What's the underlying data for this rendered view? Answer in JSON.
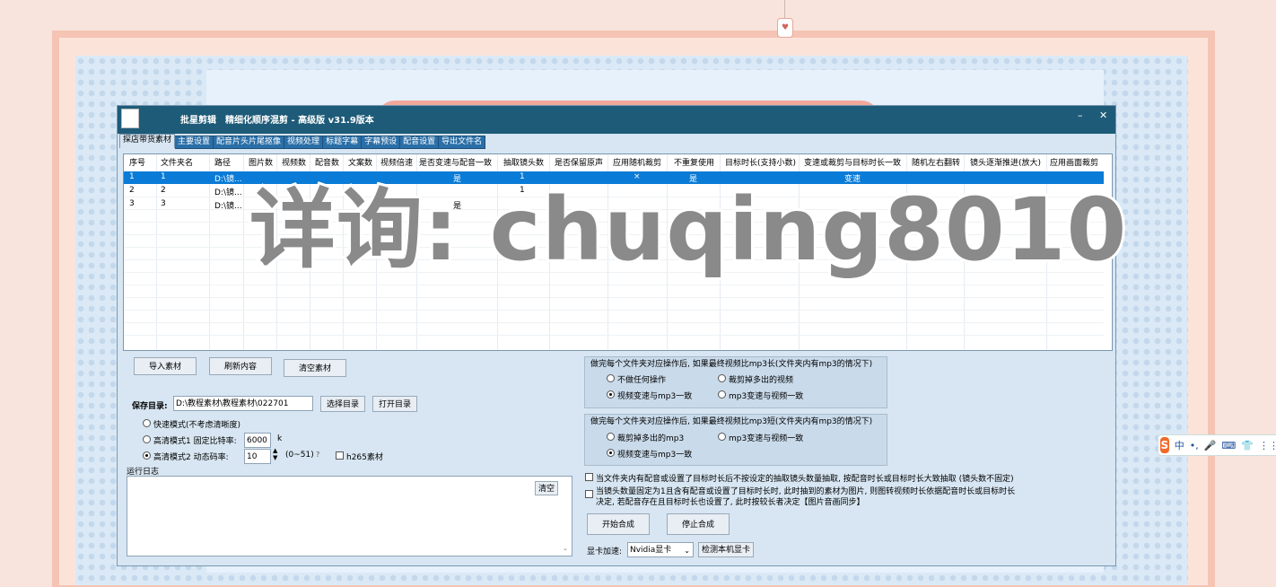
{
  "window": {
    "title_app": "批星剪辑",
    "title_detail": "精细化顺序混剪 - 高级版  v31.9版本",
    "minimize": "–",
    "close": "✕"
  },
  "tabs": [
    "探店带货素材",
    "主要设置",
    "配音片头片尾抠像",
    "视频处理",
    "标题字幕",
    "字幕预设",
    "配音设置",
    "导出文件名"
  ],
  "table": {
    "columns": [
      "序号",
      "文件夹名",
      "路径",
      "图片数",
      "视频数",
      "配音数",
      "文案数",
      "视频倍速",
      "是否变速与配音一致",
      "抽取镜头数",
      "是否保留原声",
      "应用随机裁剪",
      "不重复使用",
      "目标时长(支持小数)",
      "变速或裁剪与目标时长一致",
      "随机左右翻转",
      "镜头逐渐推进(放大)",
      "应用画面裁剪"
    ],
    "rows": [
      {
        "no": "1",
        "folder": "1",
        "path": "D:\\镜...",
        "same_speed": "是",
        "shots": "1",
        "random_crop": "×",
        "no_repeat": "是",
        "match": "变速"
      },
      {
        "no": "2",
        "folder": "2",
        "path": "D:\\镜...",
        "same_speed": "",
        "shots": "1",
        "random_crop": "",
        "no_repeat": "",
        "match": ""
      },
      {
        "no": "3",
        "folder": "3",
        "path": "D:\\镜...",
        "same_speed": "是",
        "shots": "",
        "random_crop": "",
        "no_repeat": "",
        "match": ""
      }
    ]
  },
  "buttons": {
    "import": "导入素材",
    "refresh": "刷新内容",
    "clear_material": "清空素材",
    "choose_dir": "选择目录",
    "open_dir": "打开目录",
    "clear_log": "清空",
    "start": "开始合成",
    "stop": "停止合成",
    "detect_gpu": "检测本机显卡"
  },
  "save": {
    "label": "保存目录:",
    "path": "D:\\教程素材\\教程素材\\022701"
  },
  "modes": {
    "fast": "快速模式(不考虑清晰度)",
    "hd1": "高清模式1 固定比特率:",
    "hd1_value": "6000",
    "hd1_unit": "k",
    "hd2": "高清模式2 动态码率:",
    "hd2_value": "10",
    "hd2_range": "(0~51)",
    "hd2_help": "?",
    "h265": "h265素材"
  },
  "log_label": "运行日志",
  "group1": {
    "title": "做完每个文件夹对应操作后, 如果最终视频比mp3长(文件夹内有mp3的情况下)",
    "opt1": "不做任何操作",
    "opt2": "裁剪掉多出的视频",
    "opt3": "视频变速与mp3一致",
    "opt4": "mp3变速与视频一致"
  },
  "group2": {
    "title": "做完每个文件夹对应操作后, 如果最终视频比mp3短(文件夹内有mp3的情况下)",
    "opt1": "裁剪掉多出的mp3",
    "opt2": "mp3变速与视频一致",
    "opt3": "视频变速与mp3一致"
  },
  "checks": {
    "c1": "当文件夹内有配音或设置了目标时长后不按设定的抽取镜头数量抽取, 按配音时长或目标时长大致抽取 (镜头数不固定)",
    "c2_line1": "当镜头数量固定为1且含有配音或设置了目标时长时, 此时抽到的素材为图片, 则图转视频时长依据配音时长或目标时长",
    "c2_line2": "决定, 若配音存在且目标时长也设置了, 此时按较长者决定【图片音画同步】"
  },
  "gpu": {
    "label": "显卡加速:",
    "value": "Nvidia显卡"
  },
  "watermark": "详询: chuqing8010",
  "ime": {
    "logo": "S",
    "items": [
      "中",
      "•,",
      "🎤",
      "⌨",
      "👕",
      "⋮⋮"
    ]
  },
  "tag": {
    "glyph": "♥"
  },
  "colors": {
    "titlebar": "#1e5b78",
    "selected_row": "#0a7bd6",
    "tab": "#2a6fa8"
  }
}
